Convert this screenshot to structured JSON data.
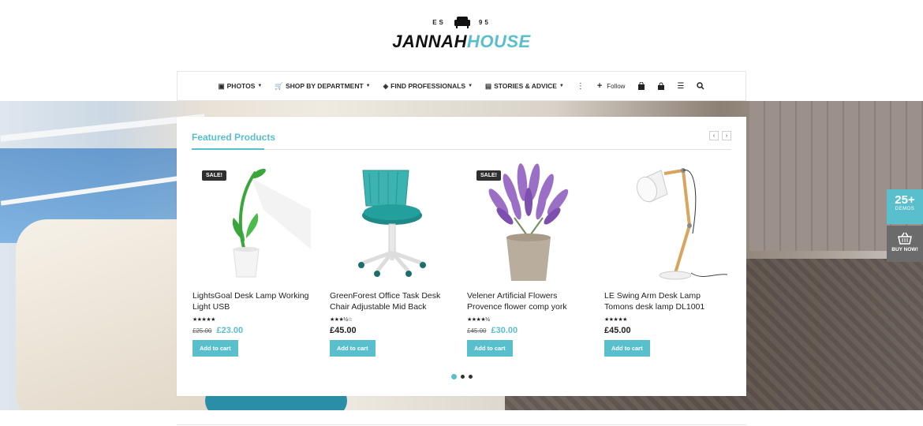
{
  "logo": {
    "left": "ES",
    "right": "95",
    "name_part1": "JANNAH",
    "name_part2": "HOUSE",
    "icon": "sofa-icon"
  },
  "nav": {
    "items": [
      {
        "label": "PHOTOS",
        "icon": "image-icon"
      },
      {
        "label": "SHOP BY DEPARTMENT",
        "icon": "cart-icon"
      },
      {
        "label": "FIND PROFESSIONALS",
        "icon": "cube-icon"
      },
      {
        "label": "STORIES & ADVICE",
        "icon": "book-icon"
      }
    ],
    "follow_label": "Follow"
  },
  "side": {
    "demos_count": "25+",
    "demos_label": "DEMOS",
    "buy_label": "BUY NOW!"
  },
  "featured": {
    "title": "Featured Products",
    "products": [
      {
        "name": "LightsGoal Desk Lamp Working Light USB",
        "sale_badge": "SALE!",
        "rating": 5,
        "old_price": "£25.00",
        "price": "£23.00",
        "button": "Add to cart"
      },
      {
        "name": "GreenForest Office Task Desk Chair Adjustable Mid Back",
        "sale_badge": "",
        "rating": 3.5,
        "old_price": "",
        "price": "£45.00",
        "button": "Add to cart"
      },
      {
        "name": "Velener Artificial Flowers Provence flower comp york",
        "sale_badge": "SALE!",
        "rating": 4.5,
        "old_price": "£45.00",
        "price": "£30.00",
        "button": "Add to cart"
      },
      {
        "name": "LE Swing Arm Desk Lamp Tomons desk lamp DL1001",
        "sale_badge": "",
        "rating": 5,
        "old_price": "",
        "price": "£45.00",
        "button": "Add to cart"
      }
    ],
    "stars": [
      "★★★★★",
      "★★★½☆",
      "★★★★½",
      "★★★★★"
    ],
    "page_count": 3,
    "active_page": 1
  },
  "colors": {
    "accent": "#59bfcc",
    "text": "#222222",
    "badge": "#2f2f2f"
  }
}
